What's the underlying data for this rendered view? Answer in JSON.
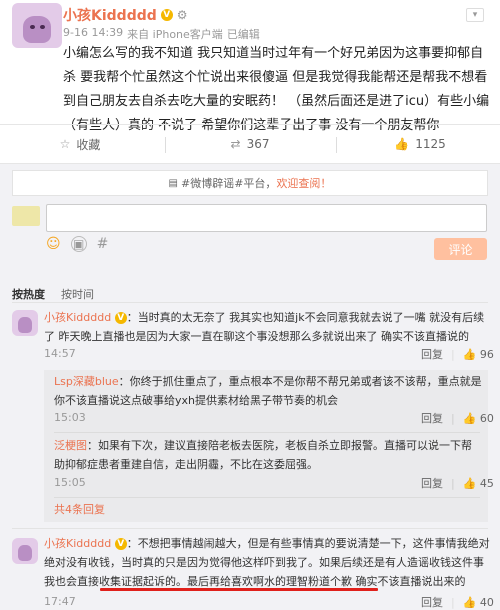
{
  "post": {
    "username": "小孩Kiddddd",
    "time": "9-16 14:39",
    "source": "来自 iPhone客户端",
    "edited": "已编辑",
    "text": "小编怎么写的我不知道 我只知道当时过年有一个好兄弟因为这事要抑郁自杀 要我帮个忙虽然这个忙说出来很傻逼 但是我觉得我能帮还是帮我不想看到自己朋友去自杀去吃大量的安眠药！ （虽然后面还是进了icu）有些小编（有些人）真的 不说了 希望你们这辈子出了事 没有一个朋友帮你"
  },
  "actions": {
    "favorite": "收藏",
    "repost_count": "367",
    "like_count": "1125"
  },
  "notice": {
    "text": "#微博辟谣#平台，",
    "link": "欢迎查阅！"
  },
  "comment_box": {
    "submit": "评论"
  },
  "sort_tabs": [
    "按热度",
    "按时间"
  ],
  "comments": [
    {
      "user": "小孩Kiddddd",
      "text": "当时真的太无奈了 我其实也知道jk不会同意我就去说了一嘴 就没有后续了 昨天晚上直播也是因为大家一直在聊这个事没想那么多就说出来了 确实不该直播说的",
      "time": "14:57",
      "reply": "回复",
      "likes": "96",
      "replies": [
        {
          "user": "Lsp深藏blue",
          "text": "你终于抓住重点了，重点根本不是你帮不帮兄弟或者该不该帮，重点就是你不该直播说这点破事给yxh提供素材给黑子带节奏的机会",
          "time": "15:03",
          "reply": "回复",
          "likes": "60"
        },
        {
          "user": "泛梗图",
          "text": "如果有下次，建议直接陪老板去医院，老板自杀立即报警。直播可以说一下帮助抑郁症患者重建自信，走出阴霾，不比在这委屈强。",
          "time": "15:05",
          "reply": "回复",
          "likes": "45"
        }
      ],
      "more": "共4条回复"
    },
    {
      "user": "小孩Kiddddd",
      "text_a": "不想把事情越闹越大，但是有些事情真的要说清楚一下，这件事情我绝对绝对没有收钱，当时真的只是因为觉得他这样吓到我了。如果后续还是有人造谣收钱这件事我也会直接收集证据起诉的。",
      "text_b": "最后再给喜欢啊水的理智粉道个歉 确实不该直播说出来的",
      "time": "17:47",
      "reply": "回复",
      "likes": "40"
    }
  ],
  "colors": {
    "username": "#eb7350",
    "vip_badge": "#f5b800",
    "submit_disabled": "#ffc09f",
    "underline": "#e0201b"
  }
}
